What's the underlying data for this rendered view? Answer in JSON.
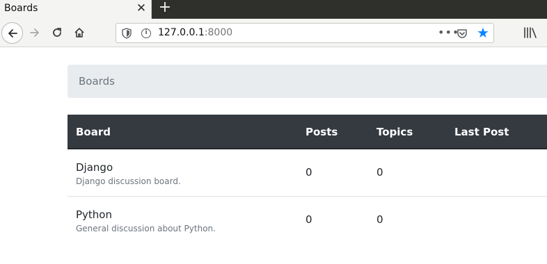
{
  "browser": {
    "tab_title": "Boards",
    "tab_close": "✕",
    "new_tab": "+",
    "url_host": "127.0.0.1",
    "url_port": ":8000"
  },
  "breadcrumb": {
    "items": [
      "Boards"
    ]
  },
  "table": {
    "headers": [
      "Board",
      "Posts",
      "Topics",
      "Last Post"
    ],
    "rows": [
      {
        "name": "Django",
        "description": "Django discussion board.",
        "posts": "0",
        "topics": "0",
        "last_post": ""
      },
      {
        "name": "Python",
        "description": "General discussion about Python.",
        "posts": "0",
        "topics": "0",
        "last_post": ""
      }
    ]
  },
  "colors": {
    "table_header_bg": "#343a40",
    "breadcrumb_bg": "#e9ecef",
    "star_blue": "#0a84ff"
  }
}
